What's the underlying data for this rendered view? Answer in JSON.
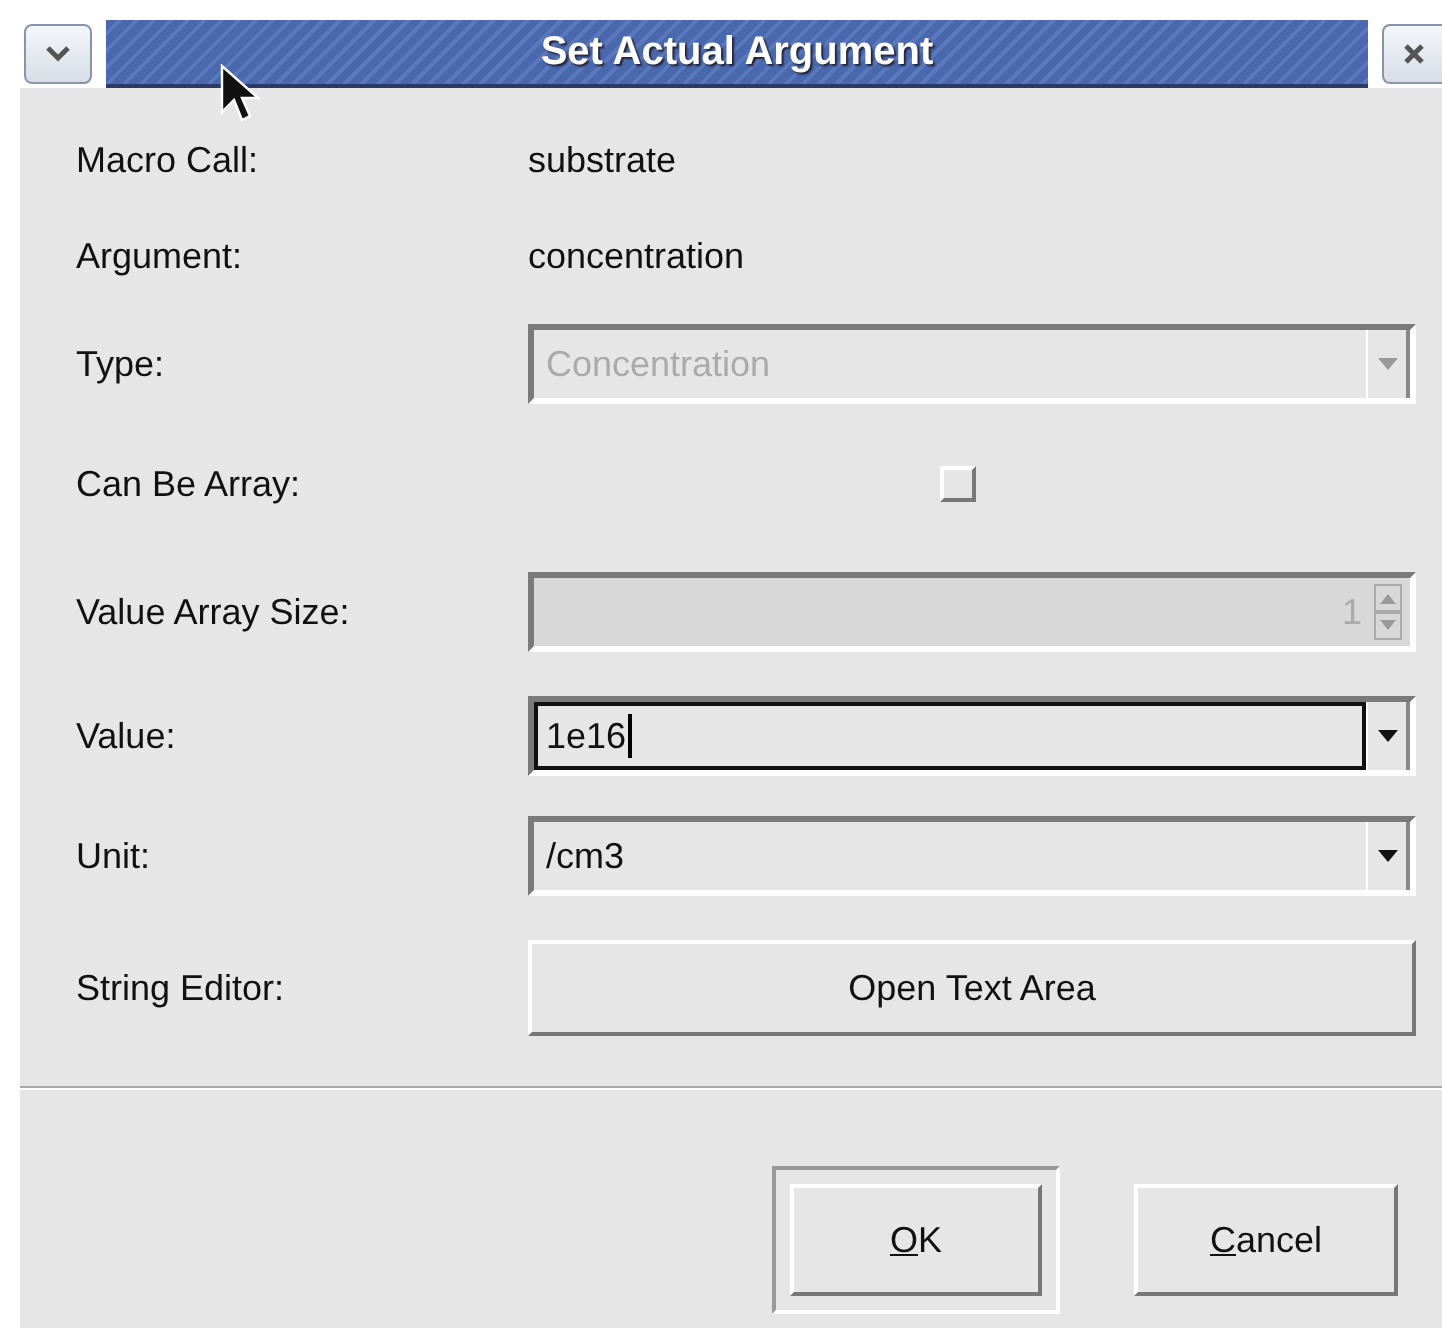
{
  "window": {
    "title": "Set Actual Argument"
  },
  "fields": [
    {
      "kind": "text",
      "label": "Macro Call:",
      "value": "substrate"
    },
    {
      "kind": "text",
      "label": "Argument:",
      "value": "concentration"
    },
    {
      "kind": "combo",
      "label": "Type:",
      "value": "Concentration",
      "disabled": true,
      "focused": false
    },
    {
      "kind": "checkbox",
      "label": "Can Be Array:",
      "checked": false
    },
    {
      "kind": "spinner",
      "label": "Value Array Size:",
      "value": "1",
      "disabled": true
    },
    {
      "kind": "combo",
      "label": "Value:",
      "value": "1e16",
      "disabled": false,
      "focused": true
    },
    {
      "kind": "combo",
      "label": "Unit:",
      "value": "/cm3",
      "disabled": false,
      "focused": false
    },
    {
      "kind": "button",
      "label": "String Editor:",
      "value": "Open Text Area"
    }
  ],
  "buttons": [
    {
      "label": "OK",
      "default": true,
      "underline_first": true
    },
    {
      "label": "Cancel",
      "default": false,
      "underline_first": true
    }
  ]
}
